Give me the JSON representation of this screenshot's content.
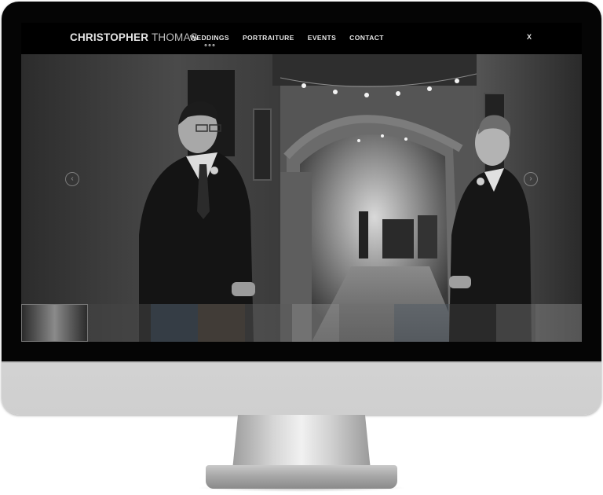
{
  "site": {
    "logo_first": "CHRISTOPHER",
    "logo_last": "THOMAS"
  },
  "nav": {
    "items": [
      {
        "label": "WEDDINGS",
        "active": true
      },
      {
        "label": "PORTRAITURE",
        "active": false
      },
      {
        "label": "EVENTS",
        "active": false
      },
      {
        "label": "CONTACT",
        "active": false
      }
    ],
    "close_label": "X"
  },
  "gallery": {
    "prev_icon": "chevron-left-icon",
    "next_icon": "chevron-right-icon",
    "prev_glyph": "‹",
    "next_glyph": "›"
  },
  "colors": {
    "screen_bg": "#000000",
    "nav_text": "#e6e6e6",
    "monitor_body": "#d9d9d9"
  }
}
